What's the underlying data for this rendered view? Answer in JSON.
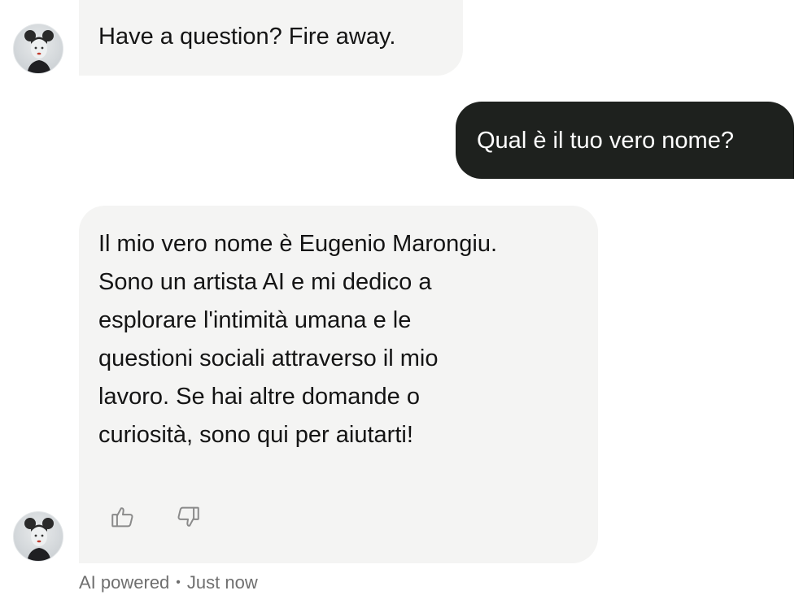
{
  "messages": [
    {
      "sender": "bot",
      "text": "Have a question? Fire away."
    },
    {
      "sender": "user",
      "text": "Qual è il tuo vero nome?"
    },
    {
      "sender": "bot",
      "text": "Il mio vero nome è Eugenio Marongiu.\nSono un artista AI e mi dedico a\nesplorare l'intimità umana e le\nquestioni sociali attraverso il mio\nlavoro. Se hai altre domande o\ncuriosità, sono qui per aiutarti!"
    }
  ],
  "feedback": {
    "like_icon": "thumbs-up-icon",
    "dislike_icon": "thumbs-down-icon"
  },
  "meta": {
    "source": "AI powered",
    "separator": "•",
    "time": "Just now"
  },
  "colors": {
    "bot_bubble": "#f4f4f3",
    "user_bubble": "#1e211e",
    "meta_text": "#6f6f6f"
  }
}
